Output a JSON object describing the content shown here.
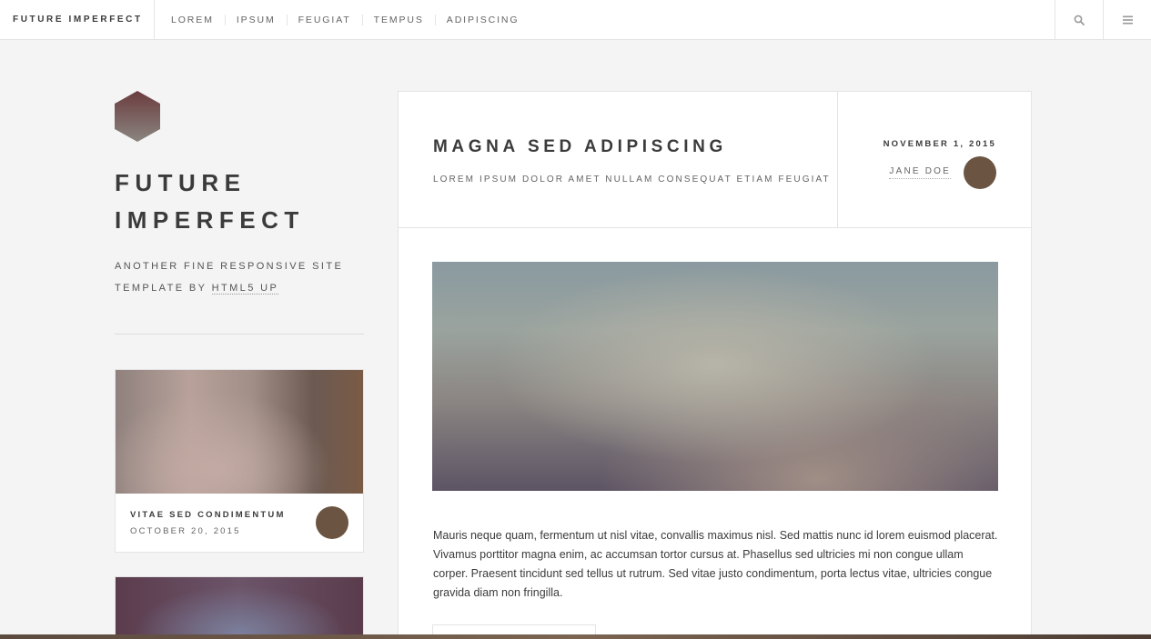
{
  "header": {
    "brand": "FUTURE IMPERFECT",
    "nav": [
      "LOREM",
      "IPSUM",
      "FEUGIAT",
      "TEMPUS",
      "ADIPISCING"
    ],
    "icons": [
      "search-icon",
      "menu-icon"
    ]
  },
  "sidebar": {
    "title": "FUTURE IMPERFECT",
    "tagline_text": "ANOTHER FINE RESPONSIVE SITE TEMPLATE BY",
    "tagline_link": "HTML5 UP",
    "mini_post": {
      "title": "VITAE SED CONDIMENTUM",
      "date": "OCTOBER 20, 2015"
    }
  },
  "post": {
    "title": "MAGNA SED ADIPISCING",
    "subtitle": "LOREM IPSUM DOLOR AMET NULLAM CONSEQUAT ETIAM FEUGIAT",
    "date": "NOVEMBER 1, 2015",
    "author": "JANE DOE",
    "body": "Mauris neque quam, fermentum ut nisl vitae, convallis maximus nisl. Sed mattis nunc id lorem euismod placerat. Vivamus porttitor magna enim, ac accumsan tortor cursus at. Phasellus sed ultricies mi non congue ullam corper. Praesent tincidunt sed tellus ut rutrum. Sed vitae justo condimentum, porta lectus vitae, ultricies congue gravida diam non fringilla."
  },
  "colors": {
    "background": "#f4f4f4",
    "text": "#3c3b3b",
    "avatar": "#6b5542"
  }
}
